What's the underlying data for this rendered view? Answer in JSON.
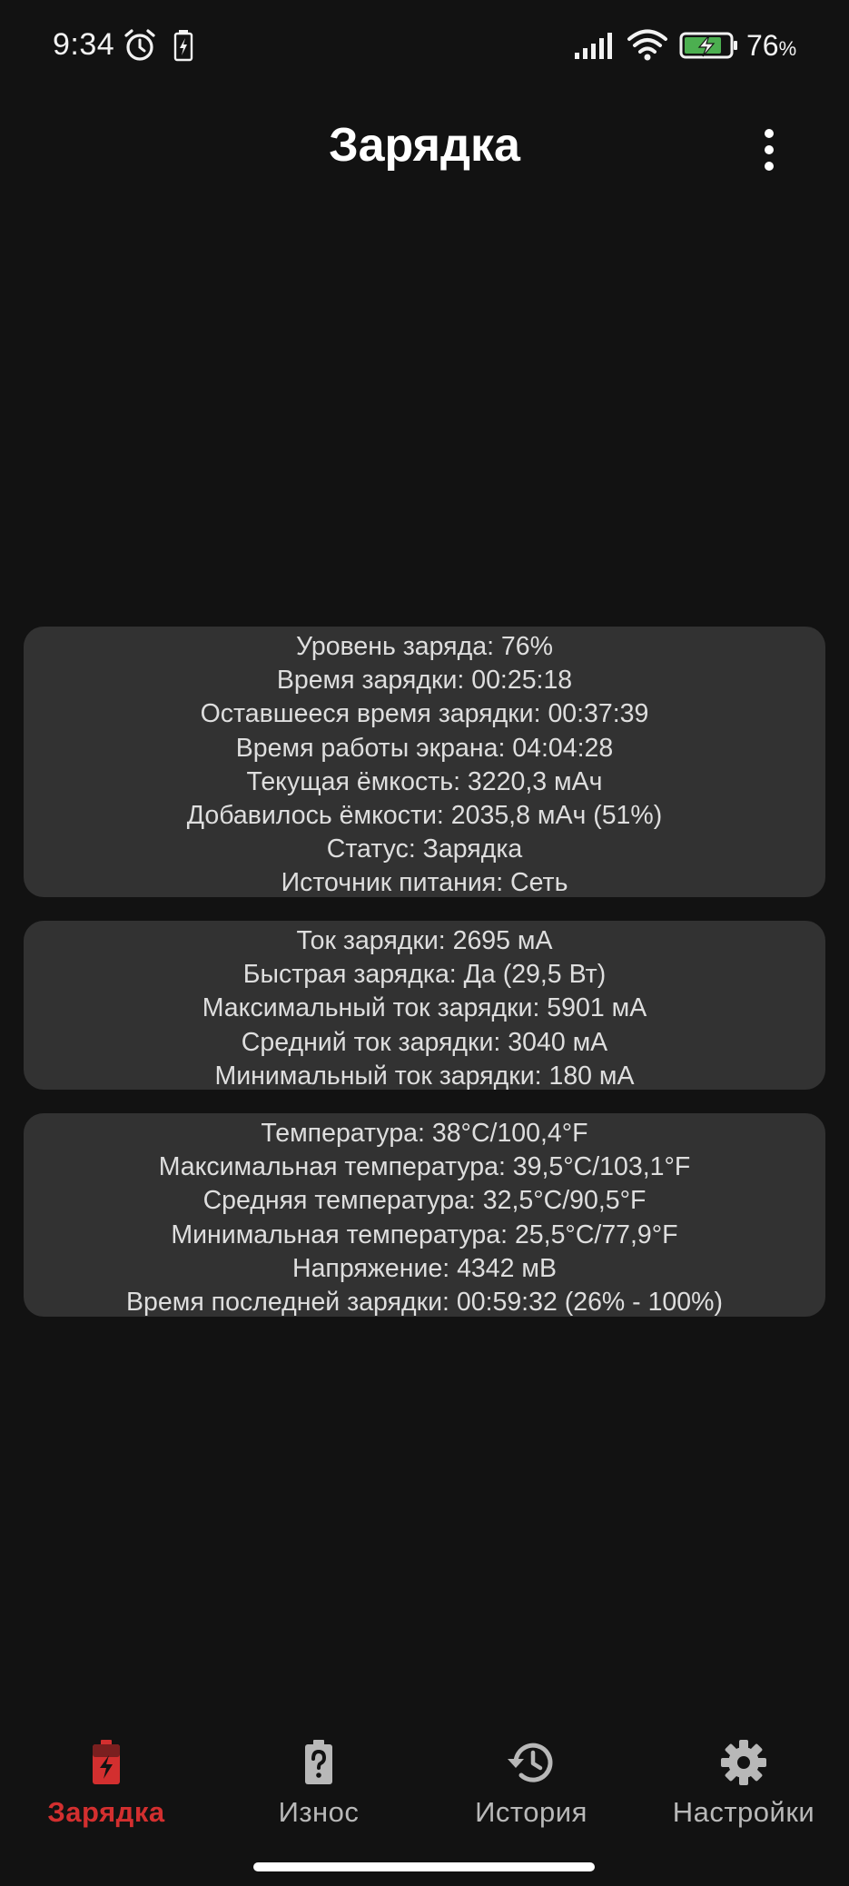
{
  "status_bar": {
    "time": "9:34",
    "battery_percent": "76",
    "battery_percent_sign": "%",
    "icons": [
      "alarm-icon",
      "battery-charging-small-icon",
      "signal-icon",
      "wifi-icon",
      "battery-status-icon"
    ]
  },
  "app_bar": {
    "title": "Зарядка",
    "menu_icon": "more-vertical-icon"
  },
  "cards": {
    "charge": {
      "rows": [
        "Уровень заряда: 76%",
        "Время зарядки: 00:25:18",
        "Оставшееся время зарядки: 00:37:39",
        "Время работы экрана: 04:04:28",
        "Текущая ёмкость: 3220,3 мАч",
        "Добавилось ёмкости: 2035,8 мАч (51%)",
        "Статус: Зарядка",
        "Источник питания: Сеть"
      ]
    },
    "current": {
      "rows": [
        "Ток зарядки: 2695 мА",
        "Быстрая зарядка: Да (29,5 Вт)",
        "Максимальный ток зарядки: 5901 мА",
        "Средний ток зарядки: 3040 мА",
        "Минимальный ток зарядки: 180 мА"
      ]
    },
    "temperature": {
      "rows": [
        "Температура: 38°C/100,4°F",
        "Максимальная температура: 39,5°C/103,1°F",
        "Средняя температура: 32,5°C/90,5°F",
        "Минимальная температура: 25,5°C/77,9°F",
        "Напряжение: 4342 мВ",
        "Время последней зарядки: 00:59:32 (26% - 100%)"
      ]
    }
  },
  "bottom_nav": {
    "items": [
      {
        "label": "Зарядка",
        "icon": "battery-charging-icon",
        "active": true
      },
      {
        "label": "Износ",
        "icon": "battery-unknown-icon",
        "active": false
      },
      {
        "label": "История",
        "icon": "history-icon",
        "active": false
      },
      {
        "label": "Настройки",
        "icon": "gear-icon",
        "active": false
      }
    ]
  },
  "colors": {
    "background": "#121212",
    "card": "#323232",
    "accent": "#d32f2f",
    "battery_status_fill": "#4caf50"
  }
}
